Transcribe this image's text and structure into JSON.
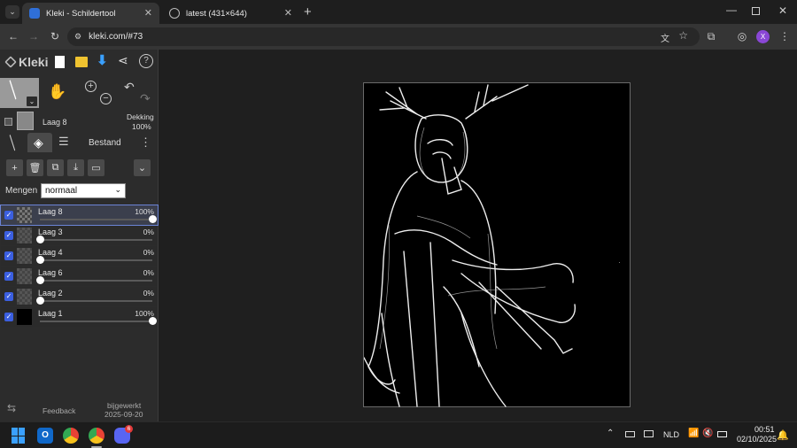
{
  "browser": {
    "tabs": [
      {
        "title": "Kleki - Schildertool",
        "active": true
      },
      {
        "title": "latest (431×644)",
        "active": false
      }
    ],
    "url": "kleki.com/#73",
    "profile_initial": "X"
  },
  "app": {
    "logo": "Kleki",
    "current_layer": {
      "name": "Laag 8",
      "opacity_label": "Dekking",
      "opacity_value": "100%"
    },
    "tabs": {
      "file_label": "Bestand"
    },
    "blend": {
      "label": "Mengen",
      "value": "normaal"
    },
    "layers": [
      {
        "name": "Laag 8",
        "opacity": "100%",
        "level": 1.0,
        "selected": true
      },
      {
        "name": "Laag 3",
        "opacity": "0%",
        "level": 0.0,
        "selected": false
      },
      {
        "name": "Laag 4",
        "opacity": "0%",
        "level": 0.0,
        "selected": false
      },
      {
        "name": "Laag 6",
        "opacity": "0%",
        "level": 0.0,
        "selected": false
      },
      {
        "name": "Laag 2",
        "opacity": "0%",
        "level": 0.0,
        "selected": false
      },
      {
        "name": "Laag 1",
        "opacity": "100%",
        "level": 1.0,
        "selected": false
      }
    ],
    "footer": {
      "feedback": "Feedback",
      "updated_label": "bijgewerkt",
      "updated_date": "2025-09-20"
    }
  },
  "taskbar": {
    "language": "NLD",
    "time": "00:51",
    "date": "02/10/2025",
    "outlook_badge": "",
    "discord_badge": "6"
  },
  "colors": {
    "accent": "#3b5fe0",
    "selection": "#6b84d6",
    "download": "#3aa0ff"
  }
}
